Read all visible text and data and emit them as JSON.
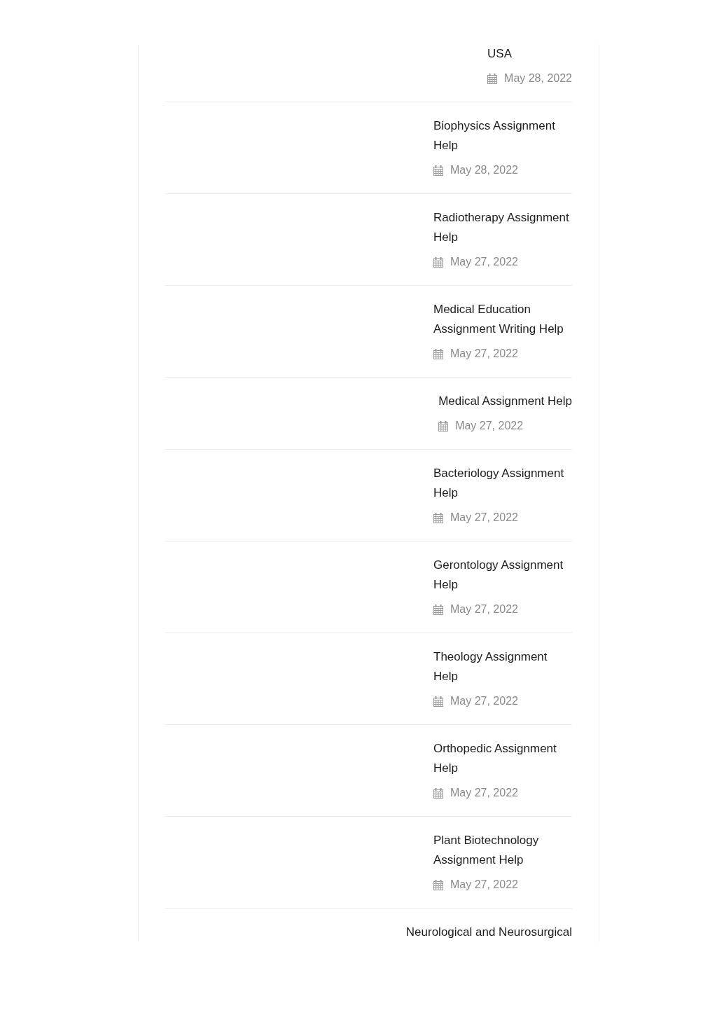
{
  "posts": [
    {
      "title": "USA",
      "date": "May 28, 2022"
    },
    {
      "title": "Biophysics Assignment Help",
      "date": "May 28, 2022"
    },
    {
      "title": "Radiotherapy Assignment Help",
      "date": "May 27, 2022"
    },
    {
      "title": "Medical Education Assignment Writing Help",
      "date": "May 27, 2022"
    },
    {
      "title": "Medical Assignment Help",
      "date": "May 27, 2022"
    },
    {
      "title": "Bacteriology Assignment Help",
      "date": "May 27, 2022"
    },
    {
      "title": "Gerontology Assignment Help",
      "date": "May 27, 2022"
    },
    {
      "title": "Theology Assignment Help",
      "date": "May 27, 2022"
    },
    {
      "title": "Orthopedic Assignment Help",
      "date": "May 27, 2022"
    },
    {
      "title": "Plant Biotechnology Assignment Help",
      "date": "May 27, 2022"
    },
    {
      "title": "Neurological and Neurosurgical"
    }
  ]
}
